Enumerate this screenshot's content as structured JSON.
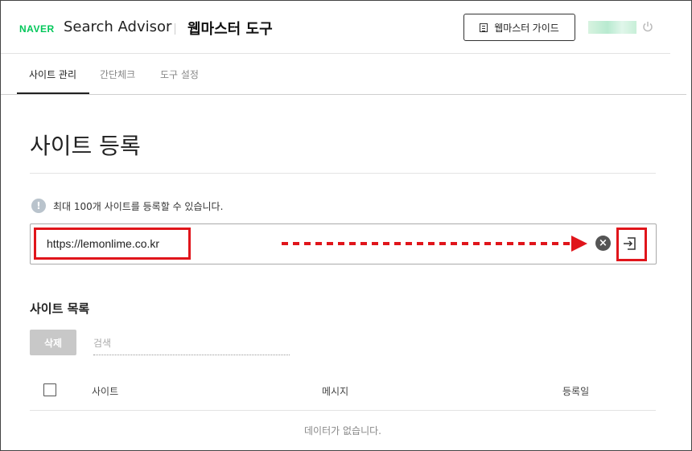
{
  "header": {
    "logo": "NAVER",
    "brand": "Search Advisor",
    "title": "웹마스터 도구",
    "guide_button": "웹마스터 가이드",
    "power_icon": "power-icon",
    "guide_icon": "document-list-icon"
  },
  "tabs": [
    {
      "label": "사이트 관리",
      "active": true
    },
    {
      "label": "간단체크",
      "active": false
    },
    {
      "label": "도구 설정",
      "active": false
    }
  ],
  "main": {
    "title": "사이트 등록",
    "notice": "최대 100개 사이트를 등록할 수 있습니다.",
    "notice_icon": "!",
    "url_input": {
      "value": "https://lemonlime.co.kr",
      "placeholder": ""
    },
    "clear_icon": "×"
  },
  "site_list": {
    "title": "사이트 목록",
    "delete_button": "삭제",
    "search_placeholder": "검색",
    "columns": [
      "사이트",
      "메시지",
      "등록일"
    ],
    "empty_message": "데이터가 없습니다."
  },
  "colors": {
    "naver_green": "#03c75a",
    "annotation_red": "#e0151b"
  }
}
